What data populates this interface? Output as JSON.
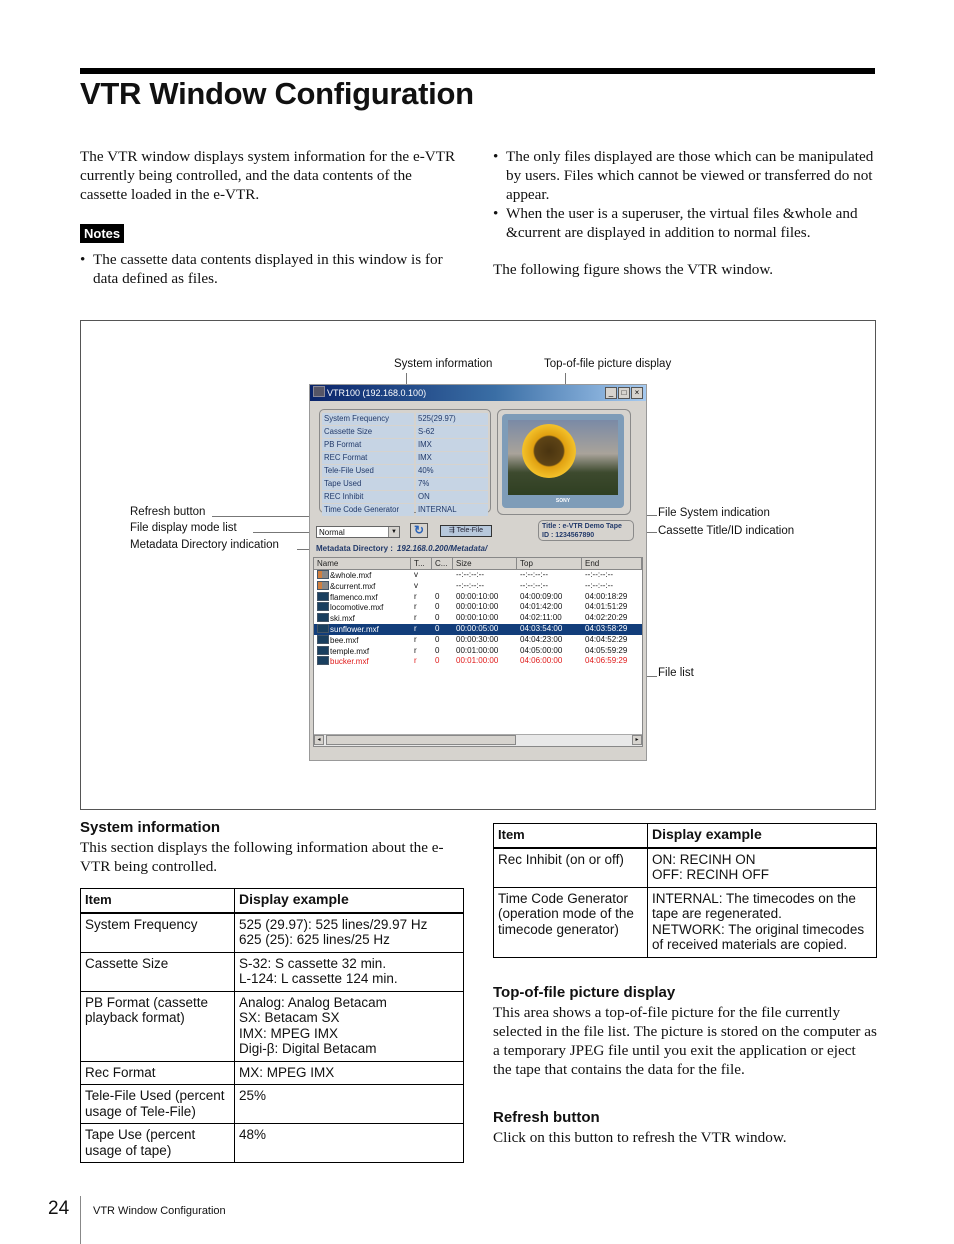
{
  "page": {
    "title": "VTR Window Configuration",
    "page_number": "24",
    "footer_text": "VTR Window Configuration"
  },
  "intro": {
    "left_paragraph": "The VTR window displays system information for the e-VTR currently being controlled, and the data contents of the cassette loaded in the e-VTR.",
    "notes_label": "Notes",
    "notes": [
      "The cassette data contents displayed in this window is for data defined as files."
    ],
    "right_bullets": [
      "The only files displayed are those which can be manipulated by users. Files which cannot be viewed or transferred do not appear.",
      "When the user is a superuser, the virtual files &whole and &current are displayed in addition to normal files."
    ],
    "following": "The following figure shows the VTR window."
  },
  "figure": {
    "callouts": {
      "system_information": "System information",
      "top_of_file": "Top-of-file picture display",
      "refresh_button": "Refresh button",
      "file_display_mode": "File display mode list",
      "metadata_directory": "Metadata Directory indication",
      "file_system": "File System indication",
      "cassette_title": "Cassette Title/ID indication",
      "file_list": "File list"
    },
    "window": {
      "title": "VTR100 (192.168.0.100)",
      "system_info": [
        {
          "key": "System Frequency",
          "value": "525(29.97)"
        },
        {
          "key": "Cassette Size",
          "value": "S-62"
        },
        {
          "key": "PB Format",
          "value": "IMX"
        },
        {
          "key": "REC Format",
          "value": "IMX"
        },
        {
          "key": "Tele-File Used",
          "value": "40%"
        },
        {
          "key": "Tape Used",
          "value": "7%"
        },
        {
          "key": "REC Inhibit",
          "value": "ON"
        },
        {
          "key": "Time Code Generator",
          "value": "INTERNAL"
        }
      ],
      "picture_brand": "SONY",
      "mode_select": "Normal",
      "telefile_label": "Tele-File",
      "cassette_title": "Title : e-VTR Demo Tape",
      "cassette_id": "ID : 1234567890",
      "metadata_label": "Metadata Directory :",
      "metadata_path": "192.168.0.200/Metadata/",
      "columns": [
        "Name",
        "T...",
        "C...",
        "Size",
        "Top",
        "End"
      ],
      "files": [
        {
          "name": "&whole.mxf",
          "t": "v",
          "c": "",
          "size": "--:--:--:--",
          "top": "--:--:--:--",
          "end": "--:--:--:--",
          "state": "virtual"
        },
        {
          "name": "&current.mxf",
          "t": "v",
          "c": "",
          "size": "--:--:--:--",
          "top": "--:--:--:--",
          "end": "--:--:--:--",
          "state": "virtual"
        },
        {
          "name": "flamenco.mxf",
          "t": "r",
          "c": "0",
          "size": "00:00:10:00",
          "top": "04:00:09:00",
          "end": "04:00:18:29",
          "state": "normal"
        },
        {
          "name": "locomotive.mxf",
          "t": "r",
          "c": "0",
          "size": "00:00:10:00",
          "top": "04:01:42:00",
          "end": "04:01:51:29",
          "state": "normal"
        },
        {
          "name": "ski.mxf",
          "t": "r",
          "c": "0",
          "size": "00:00:10:00",
          "top": "04:02:11:00",
          "end": "04:02:20:29",
          "state": "normal"
        },
        {
          "name": "sunflower.mxf",
          "t": "r",
          "c": "0",
          "size": "00:00:05:00",
          "top": "04:03:54:00",
          "end": "04:03:58:29",
          "state": "selected"
        },
        {
          "name": "bee.mxf",
          "t": "r",
          "c": "0",
          "size": "00:00:30:00",
          "top": "04:04:23:00",
          "end": "04:04:52:29",
          "state": "normal"
        },
        {
          "name": "temple.mxf",
          "t": "r",
          "c": "0",
          "size": "00:01:00:00",
          "top": "04:05:00:00",
          "end": "04:05:59:29",
          "state": "normal"
        },
        {
          "name": "bucker.mxf",
          "t": "r",
          "c": "0",
          "size": "00:01:00:00",
          "top": "04:06:00:00",
          "end": "04:06:59:29",
          "state": "red"
        }
      ]
    }
  },
  "system_information": {
    "heading": "System information",
    "description": "This section displays the following information about the e-VTR being controlled.",
    "table_headers": [
      "Item",
      "Display example"
    ],
    "rows": [
      {
        "item": "System Frequency",
        "example": [
          "525 (29.97): 525 lines/29.97 Hz",
          "625 (25): 625 lines/25 Hz"
        ]
      },
      {
        "item": "Cassette Size",
        "example": [
          "S-32: S cassette 32 min.",
          "L-124: L cassette 124 min."
        ]
      },
      {
        "item": "PB Format (cassette playback format)",
        "example": [
          "Analog: Analog Betacam",
          "SX: Betacam SX",
          "IMX: MPEG IMX",
          "Digi-β: Digital Betacam"
        ]
      },
      {
        "item": "Rec Format",
        "example": [
          "MX: MPEG IMX"
        ]
      },
      {
        "item": "Tele-File Used (percent usage of Tele-File)",
        "example": [
          "25%"
        ]
      },
      {
        "item": "Tape Use (percent usage of tape)",
        "example": [
          "48%"
        ]
      }
    ]
  },
  "right_table": {
    "headers": [
      "Item",
      "Display example"
    ],
    "rows": [
      {
        "item": "Rec Inhibit (on or off)",
        "example": [
          "ON: RECINH ON",
          "OFF: RECINH OFF"
        ]
      },
      {
        "item": "Time Code Generator (operation mode of the timecode generator)",
        "example": [
          "INTERNAL: The timecodes on the tape are regenerated.",
          "NETWORK: The original timecodes of received materials are copied."
        ]
      }
    ]
  },
  "top_of_file": {
    "heading": "Top-of-file picture display",
    "text": "This area shows a top-of-file picture for the file currently selected in the file list. The picture is stored on the computer as a temporary JPEG file until you exit the application or eject the tape that contains the data for the file."
  },
  "refresh": {
    "heading": "Refresh button",
    "text": "Click on this button to refresh the VTR window."
  }
}
